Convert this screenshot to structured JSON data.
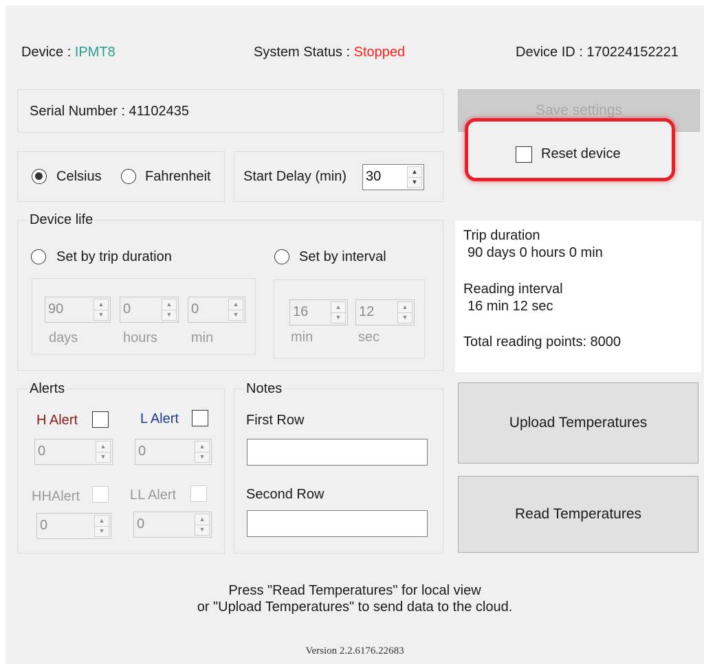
{
  "header": {
    "device_label": "Device : ",
    "device_value": "IPMT8",
    "status_label": "System Status : ",
    "status_value": "Stopped",
    "device_id": "Device ID : 170224152221"
  },
  "serial": {
    "text": "Serial Number : 41102435"
  },
  "actions": {
    "save_settings": "Save settings",
    "reset_device": "Reset device",
    "upload": "Upload Temperatures",
    "read": "Read Temperatures"
  },
  "units": {
    "celsius": "Celsius",
    "fahrenheit": "Fahrenheit",
    "selected": "Celsius"
  },
  "start_delay": {
    "label": "Start Delay (min)",
    "value": "30"
  },
  "device_life": {
    "title": "Device life",
    "by_trip": "Set by trip duration",
    "by_interval": "Set by interval",
    "trip": {
      "days": "90",
      "hours": "0",
      "min": "0",
      "days_label": "days",
      "hours_label": "hours",
      "min_label": "min"
    },
    "interval": {
      "min": "16",
      "sec": "12",
      "min_label": "min",
      "sec_label": "sec"
    }
  },
  "summary": {
    "trip_title": "Trip duration",
    "trip_value": "90 days 0 hours 0 min",
    "interval_title": "Reading interval",
    "interval_value": "16 min 12 sec",
    "total": "Total reading points: 8000"
  },
  "alerts": {
    "title": "Alerts",
    "h_label": "H Alert",
    "l_label": "L Alert",
    "hh_label": "HHAlert",
    "ll_label": "LL Alert",
    "h_value": "0",
    "l_value": "0",
    "hh_value": "0",
    "ll_value": "0"
  },
  "notes": {
    "title": "Notes",
    "first_row": "First Row",
    "second_row": "Second Row",
    "first_value": "",
    "second_value": ""
  },
  "footer": {
    "line1": "Press \"Read Temperatures\" for local view",
    "line2": "or \"Upload Temperatures\" to send data to the cloud.",
    "version": "Version 2.2.6176.22683"
  },
  "colors": {
    "device": "#2a9d8f",
    "stopped": "#ff2020",
    "h_alert": "#8b1a1a",
    "l_alert": "#1a3a8b",
    "highlight": "#e8202a"
  }
}
